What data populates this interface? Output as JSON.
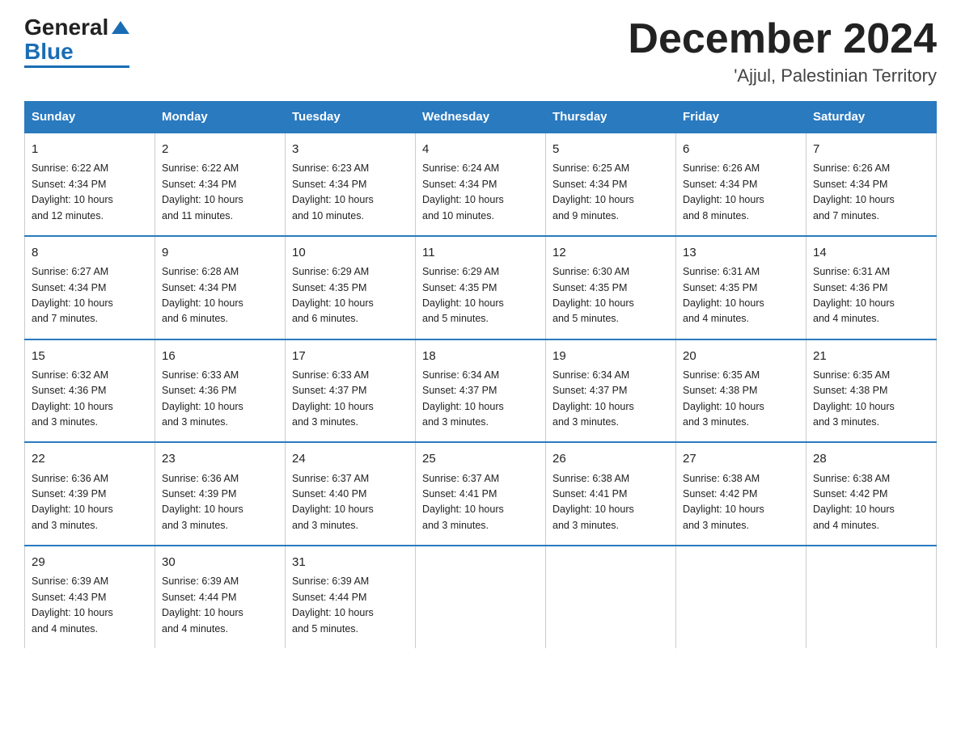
{
  "header": {
    "logo_general": "General",
    "logo_blue": "Blue",
    "month_title": "December 2024",
    "location": "'Ajjul, Palestinian Territory"
  },
  "days_of_week": [
    "Sunday",
    "Monday",
    "Tuesday",
    "Wednesday",
    "Thursday",
    "Friday",
    "Saturday"
  ],
  "weeks": [
    [
      {
        "day": "1",
        "sunrise": "6:22 AM",
        "sunset": "4:34 PM",
        "daylight": "10 hours and 12 minutes."
      },
      {
        "day": "2",
        "sunrise": "6:22 AM",
        "sunset": "4:34 PM",
        "daylight": "10 hours and 11 minutes."
      },
      {
        "day": "3",
        "sunrise": "6:23 AM",
        "sunset": "4:34 PM",
        "daylight": "10 hours and 10 minutes."
      },
      {
        "day": "4",
        "sunrise": "6:24 AM",
        "sunset": "4:34 PM",
        "daylight": "10 hours and 10 minutes."
      },
      {
        "day": "5",
        "sunrise": "6:25 AM",
        "sunset": "4:34 PM",
        "daylight": "10 hours and 9 minutes."
      },
      {
        "day": "6",
        "sunrise": "6:26 AM",
        "sunset": "4:34 PM",
        "daylight": "10 hours and 8 minutes."
      },
      {
        "day": "7",
        "sunrise": "6:26 AM",
        "sunset": "4:34 PM",
        "daylight": "10 hours and 7 minutes."
      }
    ],
    [
      {
        "day": "8",
        "sunrise": "6:27 AM",
        "sunset": "4:34 PM",
        "daylight": "10 hours and 7 minutes."
      },
      {
        "day": "9",
        "sunrise": "6:28 AM",
        "sunset": "4:34 PM",
        "daylight": "10 hours and 6 minutes."
      },
      {
        "day": "10",
        "sunrise": "6:29 AM",
        "sunset": "4:35 PM",
        "daylight": "10 hours and 6 minutes."
      },
      {
        "day": "11",
        "sunrise": "6:29 AM",
        "sunset": "4:35 PM",
        "daylight": "10 hours and 5 minutes."
      },
      {
        "day": "12",
        "sunrise": "6:30 AM",
        "sunset": "4:35 PM",
        "daylight": "10 hours and 5 minutes."
      },
      {
        "day": "13",
        "sunrise": "6:31 AM",
        "sunset": "4:35 PM",
        "daylight": "10 hours and 4 minutes."
      },
      {
        "day": "14",
        "sunrise": "6:31 AM",
        "sunset": "4:36 PM",
        "daylight": "10 hours and 4 minutes."
      }
    ],
    [
      {
        "day": "15",
        "sunrise": "6:32 AM",
        "sunset": "4:36 PM",
        "daylight": "10 hours and 3 minutes."
      },
      {
        "day": "16",
        "sunrise": "6:33 AM",
        "sunset": "4:36 PM",
        "daylight": "10 hours and 3 minutes."
      },
      {
        "day": "17",
        "sunrise": "6:33 AM",
        "sunset": "4:37 PM",
        "daylight": "10 hours and 3 minutes."
      },
      {
        "day": "18",
        "sunrise": "6:34 AM",
        "sunset": "4:37 PM",
        "daylight": "10 hours and 3 minutes."
      },
      {
        "day": "19",
        "sunrise": "6:34 AM",
        "sunset": "4:37 PM",
        "daylight": "10 hours and 3 minutes."
      },
      {
        "day": "20",
        "sunrise": "6:35 AM",
        "sunset": "4:38 PM",
        "daylight": "10 hours and 3 minutes."
      },
      {
        "day": "21",
        "sunrise": "6:35 AM",
        "sunset": "4:38 PM",
        "daylight": "10 hours and 3 minutes."
      }
    ],
    [
      {
        "day": "22",
        "sunrise": "6:36 AM",
        "sunset": "4:39 PM",
        "daylight": "10 hours and 3 minutes."
      },
      {
        "day": "23",
        "sunrise": "6:36 AM",
        "sunset": "4:39 PM",
        "daylight": "10 hours and 3 minutes."
      },
      {
        "day": "24",
        "sunrise": "6:37 AM",
        "sunset": "4:40 PM",
        "daylight": "10 hours and 3 minutes."
      },
      {
        "day": "25",
        "sunrise": "6:37 AM",
        "sunset": "4:41 PM",
        "daylight": "10 hours and 3 minutes."
      },
      {
        "day": "26",
        "sunrise": "6:38 AM",
        "sunset": "4:41 PM",
        "daylight": "10 hours and 3 minutes."
      },
      {
        "day": "27",
        "sunrise": "6:38 AM",
        "sunset": "4:42 PM",
        "daylight": "10 hours and 3 minutes."
      },
      {
        "day": "28",
        "sunrise": "6:38 AM",
        "sunset": "4:42 PM",
        "daylight": "10 hours and 4 minutes."
      }
    ],
    [
      {
        "day": "29",
        "sunrise": "6:39 AM",
        "sunset": "4:43 PM",
        "daylight": "10 hours and 4 minutes."
      },
      {
        "day": "30",
        "sunrise": "6:39 AM",
        "sunset": "4:44 PM",
        "daylight": "10 hours and 4 minutes."
      },
      {
        "day": "31",
        "sunrise": "6:39 AM",
        "sunset": "4:44 PM",
        "daylight": "10 hours and 5 minutes."
      },
      null,
      null,
      null,
      null
    ]
  ],
  "labels": {
    "sunrise": "Sunrise:",
    "sunset": "Sunset:",
    "daylight": "Daylight:"
  }
}
